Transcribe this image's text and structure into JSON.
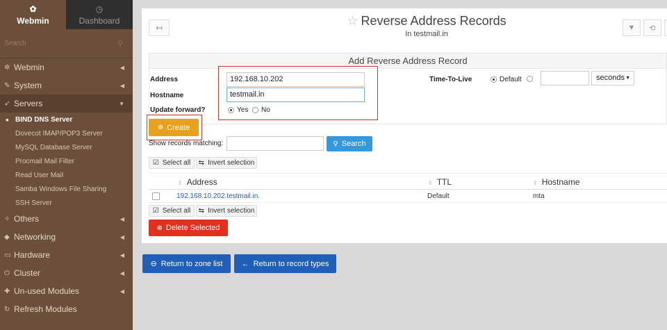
{
  "sidebar": {
    "tabs": [
      {
        "label": "Webmin",
        "icon": "webmin-logo-icon"
      },
      {
        "label": "Dashboard",
        "icon": "dashboard-icon"
      }
    ],
    "search_placeholder": "Search",
    "categories": [
      {
        "label": "Webmin",
        "icon": "gear-icon"
      },
      {
        "label": "System",
        "icon": "wrench-icon"
      },
      {
        "label": "Servers",
        "icon": "rocket-icon"
      }
    ],
    "server_items": [
      "BIND DNS Server",
      "Dovecot IMAP/POP3 Server",
      "MySQL Database Server",
      "Procmail Mail Filter",
      "Read User Mail",
      "Samba Windows File Sharing",
      "SSH Server"
    ],
    "more_categories": [
      {
        "label": "Others",
        "icon": "wand-icon"
      },
      {
        "label": "Networking",
        "icon": "shield-icon"
      },
      {
        "label": "Hardware",
        "icon": "drive-icon"
      },
      {
        "label": "Cluster",
        "icon": "power-icon"
      },
      {
        "label": "Un-used Modules",
        "icon": "puzzle-icon"
      },
      {
        "label": "Refresh Modules",
        "icon": "refresh-icon"
      }
    ]
  },
  "header": {
    "title": "Reverse Address Records",
    "subtitle": "In testmail.in"
  },
  "form": {
    "title": "Add Reverse Address Record",
    "address_label": "Address",
    "address_value": "192.168.10.202",
    "hostname_label": "Hostname",
    "hostname_value": "testmail.in",
    "update_forward_label": "Update forward?",
    "yes_label": "Yes",
    "no_label": "No",
    "ttl_label": "Time-To-Live",
    "ttl_default_label": "Default",
    "ttl_unit": "seconds"
  },
  "create_label": "Create",
  "show_records_label": "Show records matching:",
  "search_label": "Search",
  "select_all_label": "Select all",
  "invert_label": "Invert selection",
  "table": {
    "columns": [
      "Address",
      "TTL",
      "Hostname"
    ],
    "rows": [
      {
        "address": "192.168.10.202.testmail.in.",
        "ttl": "Default",
        "hostname": "mta"
      }
    ]
  },
  "delete_label": "Delete Selected",
  "return_zone_label": "Return to zone list",
  "return_types_label": "Return to record types",
  "colors": {
    "sidebar": "#6b4f3a",
    "create": "#e6a21c",
    "search": "#3498db",
    "delete": "#e0301e",
    "return": "#1f5fb8"
  }
}
